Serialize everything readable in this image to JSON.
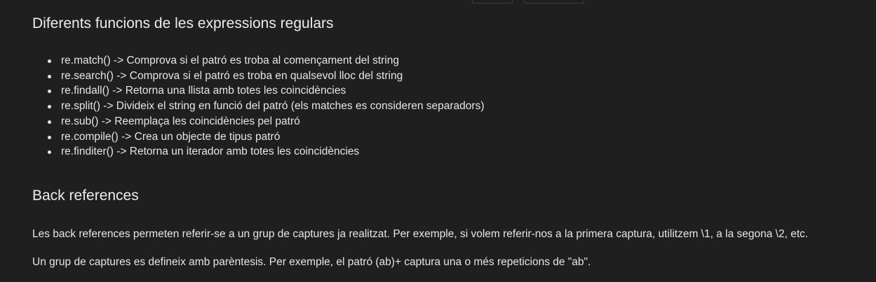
{
  "section_functions": {
    "heading": "Diferents funcions de les expressions regulars",
    "items": [
      "re.match() -> Comprova si el patró es troba al començament del string",
      "re.search() -> Comprova si el patró es troba en qualsevol lloc del string",
      "re.findall() -> Retorna una llista amb totes les coincidències",
      "re.split() -> Divideix el string en funció del patró (els matches es consideren separadors)",
      "re.sub() -> Reemplaça les coincidències pel patró",
      "re.compile() -> Crea un objecte de tipus patró",
      "re.finditer() -> Retorna un iterador amb totes les coincidències"
    ]
  },
  "section_backrefs": {
    "heading": "Back references",
    "paragraph_1": "Les back references permeten referir-se a un grup de captures ja realitzat. Per exemple, si volem referir-nos a la primera captura, utilitzem \\1, a la segona \\2, etc.",
    "paragraph_2": "Un grup de captures es defineix amb parèntesis. Per exemple, el patró (ab)+ captura una o més repeticions de \"ab\"."
  },
  "colors": {
    "background": "#1f1f1f",
    "text": "#e6e6e6"
  }
}
